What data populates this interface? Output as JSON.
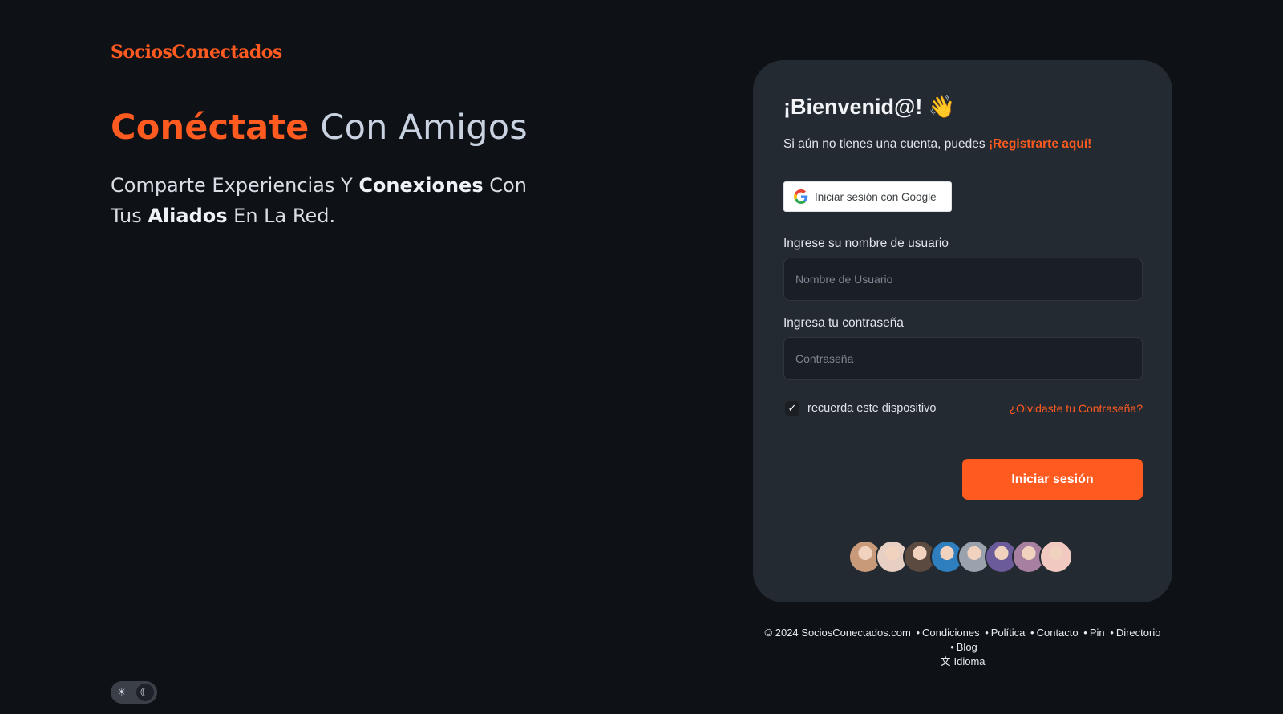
{
  "brand": {
    "logo_text": "SociosConectados"
  },
  "hero": {
    "title_accent": "Conéctate",
    "title_rest": "Con Amigos",
    "subtitle_part1": "Comparte Experiencias Y ",
    "subtitle_bold1": "Conexiones",
    "subtitle_part2": " Con Tus ",
    "subtitle_bold2": "Aliados",
    "subtitle_part3": " En La Red."
  },
  "login": {
    "welcome": "¡Bienvenid@! 👋",
    "register_prefix": "Si aún no tienes una cuenta, puedes ",
    "register_link": "¡Registrarte aquí!",
    "google_button": "Iniciar sesión con Google",
    "username_label": "Ingrese su nombre de usuario",
    "username_placeholder": "Nombre de Usuario",
    "username_value": "",
    "password_label": "Ingresa tu contraseña",
    "password_placeholder": "Contraseña",
    "password_value": "",
    "remember_label": "recuerda este dispositivo",
    "remember_checked": true,
    "forgot_link": "¿Olvidaste tu Contraseña?",
    "submit_button": "Iniciar sesión"
  },
  "avatars": [
    {
      "name": "avatar-1",
      "color": "#c99a7a"
    },
    {
      "name": "avatar-2",
      "color": "#e8cfc3"
    },
    {
      "name": "avatar-3",
      "color": "#5a4a3f"
    },
    {
      "name": "avatar-4",
      "color": "#2f7fbf"
    },
    {
      "name": "avatar-5",
      "color": "#9aa3ad"
    },
    {
      "name": "avatar-6",
      "color": "#6c5b9a"
    },
    {
      "name": "avatar-7",
      "color": "#a77fa0"
    },
    {
      "name": "avatar-8",
      "color": "#f1c9c0"
    }
  ],
  "footer": {
    "copyright": "© 2024 SociosConectados.com",
    "links": [
      "Condiciones",
      "Política",
      "Contacto",
      "Pin",
      "Directorio"
    ],
    "blog": "Blog",
    "language": "Idioma"
  },
  "theme_toggle": {
    "light_icon": "sun-icon",
    "dark_icon": "moon-icon"
  },
  "colors": {
    "accent": "#ff5a1f",
    "background": "#0e1116",
    "card": "#242a31"
  }
}
